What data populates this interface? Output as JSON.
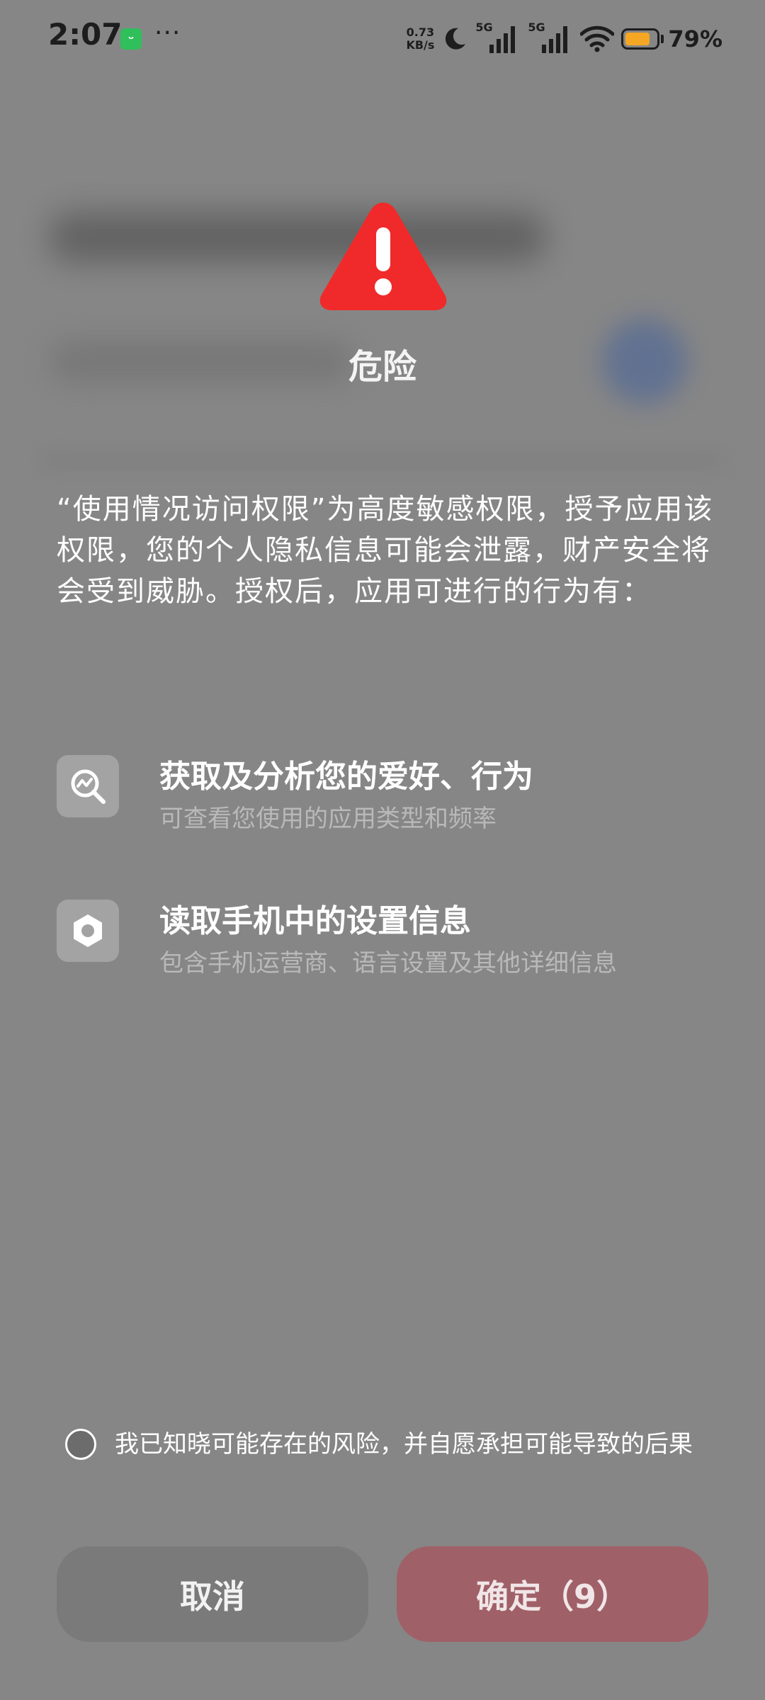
{
  "status_bar": {
    "time": "2:07",
    "app_icon": "xiaomi-home-icon",
    "more_dots": "···",
    "net_speed_value": "0.73",
    "net_speed_unit": "KB/s",
    "network_1": "5G",
    "network_2": "5G",
    "battery_level": 0.79,
    "battery_text": "79%",
    "battery_color": "#f5a623"
  },
  "dialog": {
    "icon": "warning-triangle-icon",
    "icon_color": "#f02a2a",
    "title": "危险",
    "description": "“使用情况访问权限”为高度敏感权限，授予应用该权限，您的个人隐私信息可能会泄露，财产安全将会受到威胁。授权后，应用可进行的行为有：",
    "permissions": [
      {
        "icon": "analytics-search-icon",
        "title": "获取及分析您的爱好、行为",
        "subtitle": "可查看您使用的应用类型和频率"
      },
      {
        "icon": "settings-hexagon-icon",
        "title": "读取手机中的设置信息",
        "subtitle": "包含手机运营商、语言设置及其他详细信息"
      }
    ],
    "acknowledgement": "我已知晓可能存在的风险，并自愿承担可能导致的后果",
    "acknowledged": false,
    "cancel_label": "取消",
    "confirm_label": "确定（9）",
    "confirm_color": "#a06068"
  }
}
